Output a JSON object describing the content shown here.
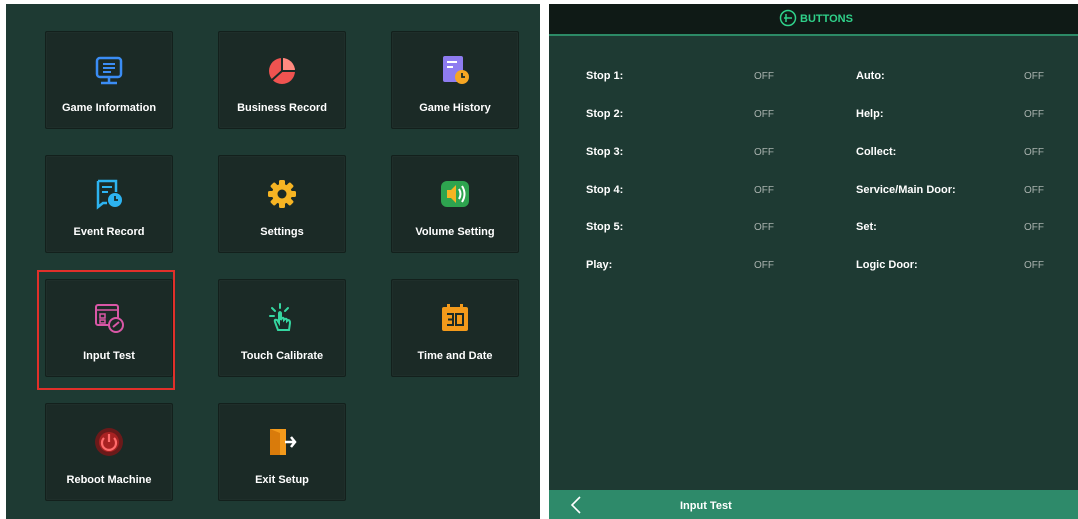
{
  "setup_menu": {
    "tiles": [
      {
        "label": "Game Information",
        "icon": "monitor-icon"
      },
      {
        "label": "Business Record",
        "icon": "pie-chart-icon"
      },
      {
        "label": "Game History",
        "icon": "history-document-icon"
      },
      {
        "label": "Event Record",
        "icon": "event-record-icon"
      },
      {
        "label": "Settings",
        "icon": "gear-icon"
      },
      {
        "label": "Volume Setting",
        "icon": "speaker-icon"
      },
      {
        "label": "Input Test",
        "icon": "input-test-icon"
      },
      {
        "label": "Touch Calibrate",
        "icon": "touch-hand-icon"
      },
      {
        "label": "Time and Date",
        "icon": "calendar-icon"
      },
      {
        "label": "Reboot Machine",
        "icon": "power-icon"
      },
      {
        "label": "Exit Setup",
        "icon": "exit-door-icon"
      }
    ],
    "selected": "Input Test"
  },
  "buttons_panel": {
    "title": "BUTTONS",
    "left_rows": [
      {
        "label": "Stop 1:",
        "value": "OFF"
      },
      {
        "label": "Stop 2:",
        "value": "OFF"
      },
      {
        "label": "Stop 3:",
        "value": "OFF"
      },
      {
        "label": "Stop 4:",
        "value": "OFF"
      },
      {
        "label": "Stop 5:",
        "value": "OFF"
      },
      {
        "label": "Play:",
        "value": "OFF"
      }
    ],
    "right_rows": [
      {
        "label": "Auto:",
        "value": "OFF"
      },
      {
        "label": "Help:",
        "value": "OFF"
      },
      {
        "label": "Collect:",
        "value": "OFF"
      },
      {
        "label": "Service/Main Door:",
        "value": "OFF"
      },
      {
        "label": "Set:",
        "value": "OFF"
      },
      {
        "label": "Logic Door:",
        "value": "OFF"
      }
    ],
    "footer_title": "Input Test"
  },
  "colors": {
    "background": "#1e3a33",
    "accent_green": "#2fd18a",
    "footer_green": "#2e8a6a",
    "selection_red": "#e0302a"
  }
}
